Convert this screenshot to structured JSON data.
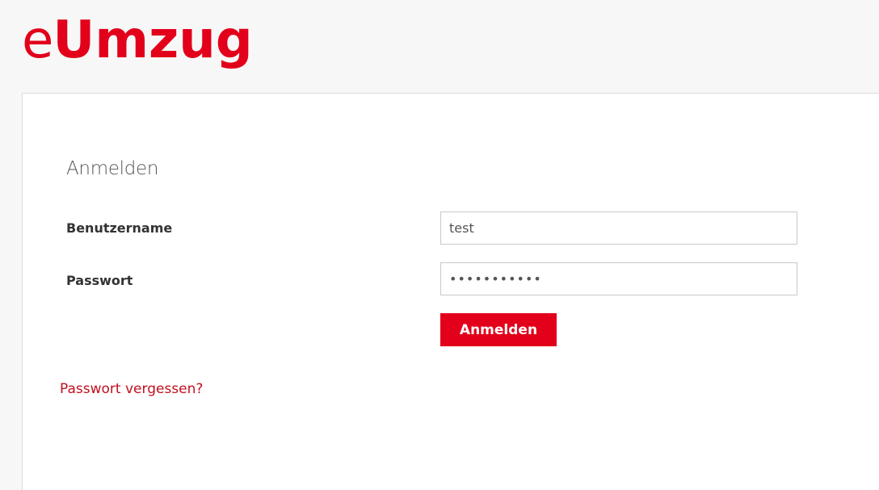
{
  "logo": {
    "prefix": "e",
    "main": "Umzug"
  },
  "form": {
    "title": "Anmelden",
    "username_label": "Benutzername",
    "username_value": "test",
    "password_label": "Passwort",
    "password_value": "•••••••••••",
    "submit_label": "Anmelden",
    "forgot_link": "Passwort vergessen?"
  },
  "colors": {
    "brand": "#e2001a",
    "link": "#c0101e",
    "page_background": "#f7f7f7",
    "panel_background": "#ffffff"
  }
}
